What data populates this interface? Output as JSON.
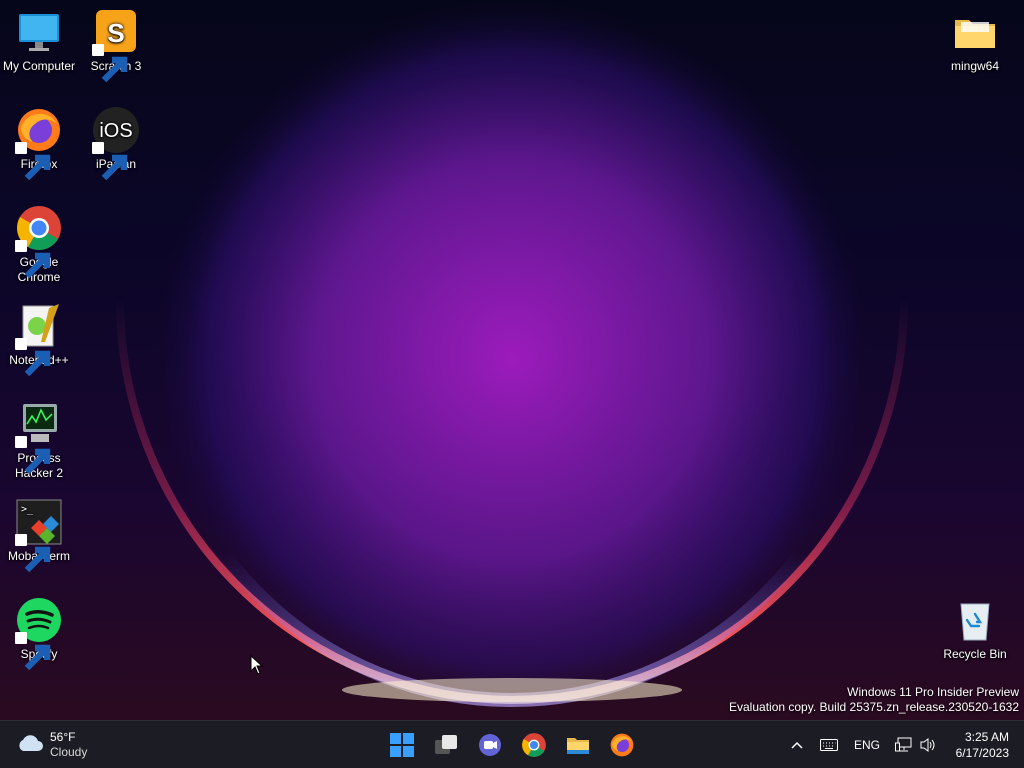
{
  "desktop": {
    "icons": [
      {
        "id": "my-computer",
        "label": "My Computer"
      },
      {
        "id": "scratch",
        "label": "Scratch 3"
      },
      {
        "id": "mingw",
        "label": "mingw64"
      },
      {
        "id": "firefox",
        "label": "Firefox"
      },
      {
        "id": "ipadian",
        "label": "iPadian"
      },
      {
        "id": "chrome",
        "label": "Google Chrome"
      },
      {
        "id": "notepadpp",
        "label": "Notepad++"
      },
      {
        "id": "processhacker",
        "label": "Process Hacker 2"
      },
      {
        "id": "mobaxterm",
        "label": "MobaXterm"
      },
      {
        "id": "spotify",
        "label": "Spotify"
      },
      {
        "id": "recyclebin",
        "label": "Recycle Bin"
      }
    ],
    "ipadian_glyph": "iOS"
  },
  "watermark": {
    "line1": "Windows 11 Pro Insider Preview",
    "line2": "Evaluation copy. Build 25375.zn_release.230520-1632"
  },
  "taskbar": {
    "weather": {
      "temp": "56°F",
      "condition": "Cloudy",
      "icon": "cloud-icon"
    },
    "apps": [
      {
        "name": "start",
        "icon": "windows-logo-icon"
      },
      {
        "name": "task-view",
        "icon": "task-view-icon"
      },
      {
        "name": "teams-chat",
        "icon": "chat-icon"
      },
      {
        "name": "chrome",
        "icon": "chrome-icon"
      },
      {
        "name": "file-explorer",
        "icon": "folder-icon"
      },
      {
        "name": "firefox",
        "icon": "firefox-icon"
      }
    ],
    "tray": {
      "overflow_icon": "chevron-up-icon",
      "keyboard_icon": "keyboard-icon",
      "language": "ENG",
      "network_icon": "network-icon",
      "volume_icon": "speaker-icon"
    },
    "clock": {
      "time": "3:25 AM",
      "date": "6/17/2023"
    }
  },
  "colors": {
    "taskbar_bg": "#1c1c24",
    "accent_blue": "#3aa0ff",
    "wallpaper_glow": "#ff3a6e"
  }
}
